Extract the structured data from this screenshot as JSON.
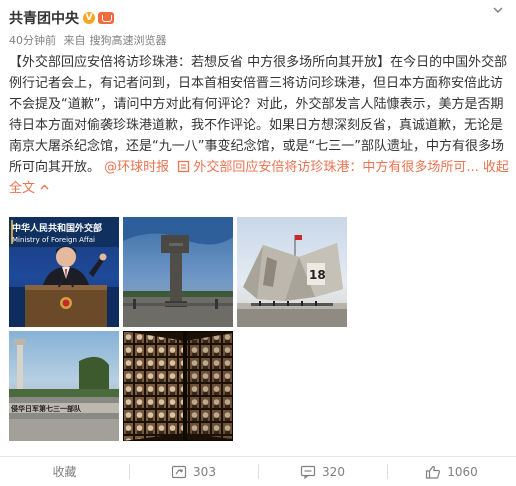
{
  "header": {
    "username": "共青团中央",
    "meta": {
      "time": "40分钟前",
      "source_prefix": "来自",
      "source": "搜狗高速浏览器"
    }
  },
  "post": {
    "headline": "【外交部回应安倍将访珍珠港：若想反省 中方很多场所向其开放】",
    "body": "在今日的中国外交部例行记者会上，有记者问到，日本首相安倍晋三将访问珍珠港，但日本方面称安倍此访不会提及“道歉”，请问中方对此有何评论？对此，外交部发言人陆慷表示，美方是否期待日本方面对偷袭珍珠港道歉，我不作评论。如果日方想深刻反省，真诚道歉，无论是南京大屠杀纪念馆，还是“九一八”事变纪念馆，或是“七三一”部队遗址，中方有很多场所可向其开放。",
    "mention": "@环球时报",
    "article_link": "外交部回应安倍将访珍珠港：中方有很多场所可...",
    "collapse": "收起全文"
  },
  "images": {
    "img1": {
      "label": "外交部发言人陆慷",
      "sign1": "中华人民共和国外交部",
      "sign2": "Ministry of Foreign Affai"
    },
    "img2": {
      "label": "纪念碑"
    },
    "img3": {
      "label": "九一八事变纪念馆",
      "num": "18"
    },
    "img4": {
      "label": "第七三一部队遗址",
      "sign": "侵华日军第七三一部队"
    },
    "img5": {
      "label": "遇难者照片墙"
    }
  },
  "actions": {
    "favorite": "收藏",
    "repost": "303",
    "comment": "320",
    "like": "1060"
  },
  "colors": {
    "link": "#eb7350",
    "text": "#333333",
    "meta": "#808080"
  }
}
